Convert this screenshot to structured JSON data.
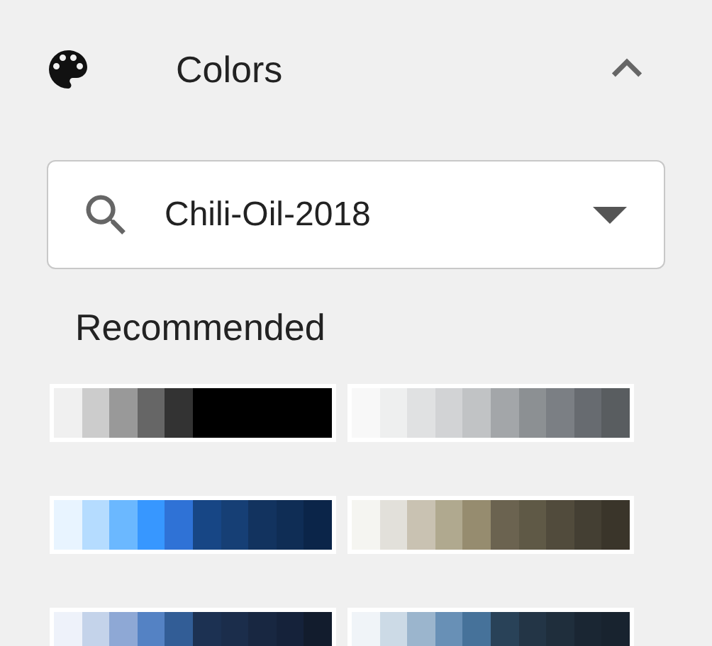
{
  "section": {
    "title": "Colors",
    "expanded": true
  },
  "palette_select": {
    "value": "Chili-Oil-2018"
  },
  "recommended": {
    "heading": "Recommended",
    "palettes": [
      {
        "swatches": [
          {
            "color": "#f0f0f0"
          },
          {
            "color": "#cccccc"
          },
          {
            "color": "#999999"
          },
          {
            "color": "#666666"
          },
          {
            "color": "#333333"
          },
          {
            "color": "#000000"
          },
          {
            "color": "#000000"
          },
          {
            "color": "#000000"
          },
          {
            "color": "#000000"
          },
          {
            "color": "#000000"
          }
        ]
      },
      {
        "swatches": [
          {
            "color": "#f8f8f8"
          },
          {
            "color": "#eeefef"
          },
          {
            "color": "#e0e1e2"
          },
          {
            "color": "#d2d3d5"
          },
          {
            "color": "#c1c3c5"
          },
          {
            "color": "#a3a6a9"
          },
          {
            "color": "#8c9093"
          },
          {
            "color": "#7b7f84"
          },
          {
            "color": "#676b70"
          },
          {
            "color": "#595d60"
          }
        ]
      },
      {
        "swatches": [
          {
            "color": "#e8f4ff"
          },
          {
            "color": "#b5dcff"
          },
          {
            "color": "#6bb8ff"
          },
          {
            "color": "#3797ff"
          },
          {
            "color": "#2f72d6"
          },
          {
            "color": "#174685"
          },
          {
            "color": "#163f75"
          },
          {
            "color": "#12335f"
          },
          {
            "color": "#0f2d55"
          },
          {
            "color": "#0b2549"
          }
        ]
      },
      {
        "swatches": [
          {
            "color": "#f5f5f1"
          },
          {
            "color": "#e2e0da"
          },
          {
            "color": "#c9c2b2"
          },
          {
            "color": "#b0a98f"
          },
          {
            "color": "#968c6f"
          },
          {
            "color": "#6b6350"
          },
          {
            "color": "#5f5946"
          },
          {
            "color": "#514b3c"
          },
          {
            "color": "#443f33"
          },
          {
            "color": "#3a352a"
          }
        ]
      },
      {
        "swatches": [
          {
            "color": "#eef2fa"
          },
          {
            "color": "#c4d3ea"
          },
          {
            "color": "#8ea8d5"
          },
          {
            "color": "#5482c4"
          },
          {
            "color": "#325d96"
          },
          {
            "color": "#1c3152"
          },
          {
            "color": "#1b2d4b"
          },
          {
            "color": "#182741"
          },
          {
            "color": "#15223a"
          },
          {
            "color": "#121c2d"
          }
        ]
      },
      {
        "swatches": [
          {
            "color": "#f0f4f8"
          },
          {
            "color": "#ccdae6"
          },
          {
            "color": "#9bb5cd"
          },
          {
            "color": "#6890b6"
          },
          {
            "color": "#46729a"
          },
          {
            "color": "#294258"
          },
          {
            "color": "#233546"
          },
          {
            "color": "#1f2e3c"
          },
          {
            "color": "#1a2633"
          },
          {
            "color": "#18232f"
          }
        ]
      }
    ]
  }
}
